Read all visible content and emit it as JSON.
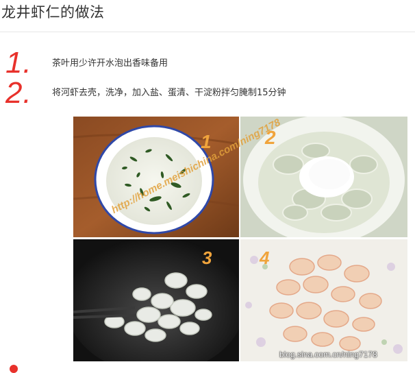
{
  "article": {
    "title": "龙井虾仁的做法"
  },
  "steps": [
    {
      "number": "1.",
      "text": "茶叶用少许开水泡出香味备用"
    },
    {
      "number": "2.",
      "text": "将河虾去壳，洗净，加入盐、蛋清、干淀粉拌匀腌制15分钟"
    }
  ],
  "photos": [
    {
      "label": "1"
    },
    {
      "label": "2"
    },
    {
      "label": "3"
    },
    {
      "label": "4"
    }
  ],
  "watermarks": {
    "diagonal": "http://home.meishichina.com/ning7178",
    "blog": "blog.sina.com.cn/ning7178"
  }
}
